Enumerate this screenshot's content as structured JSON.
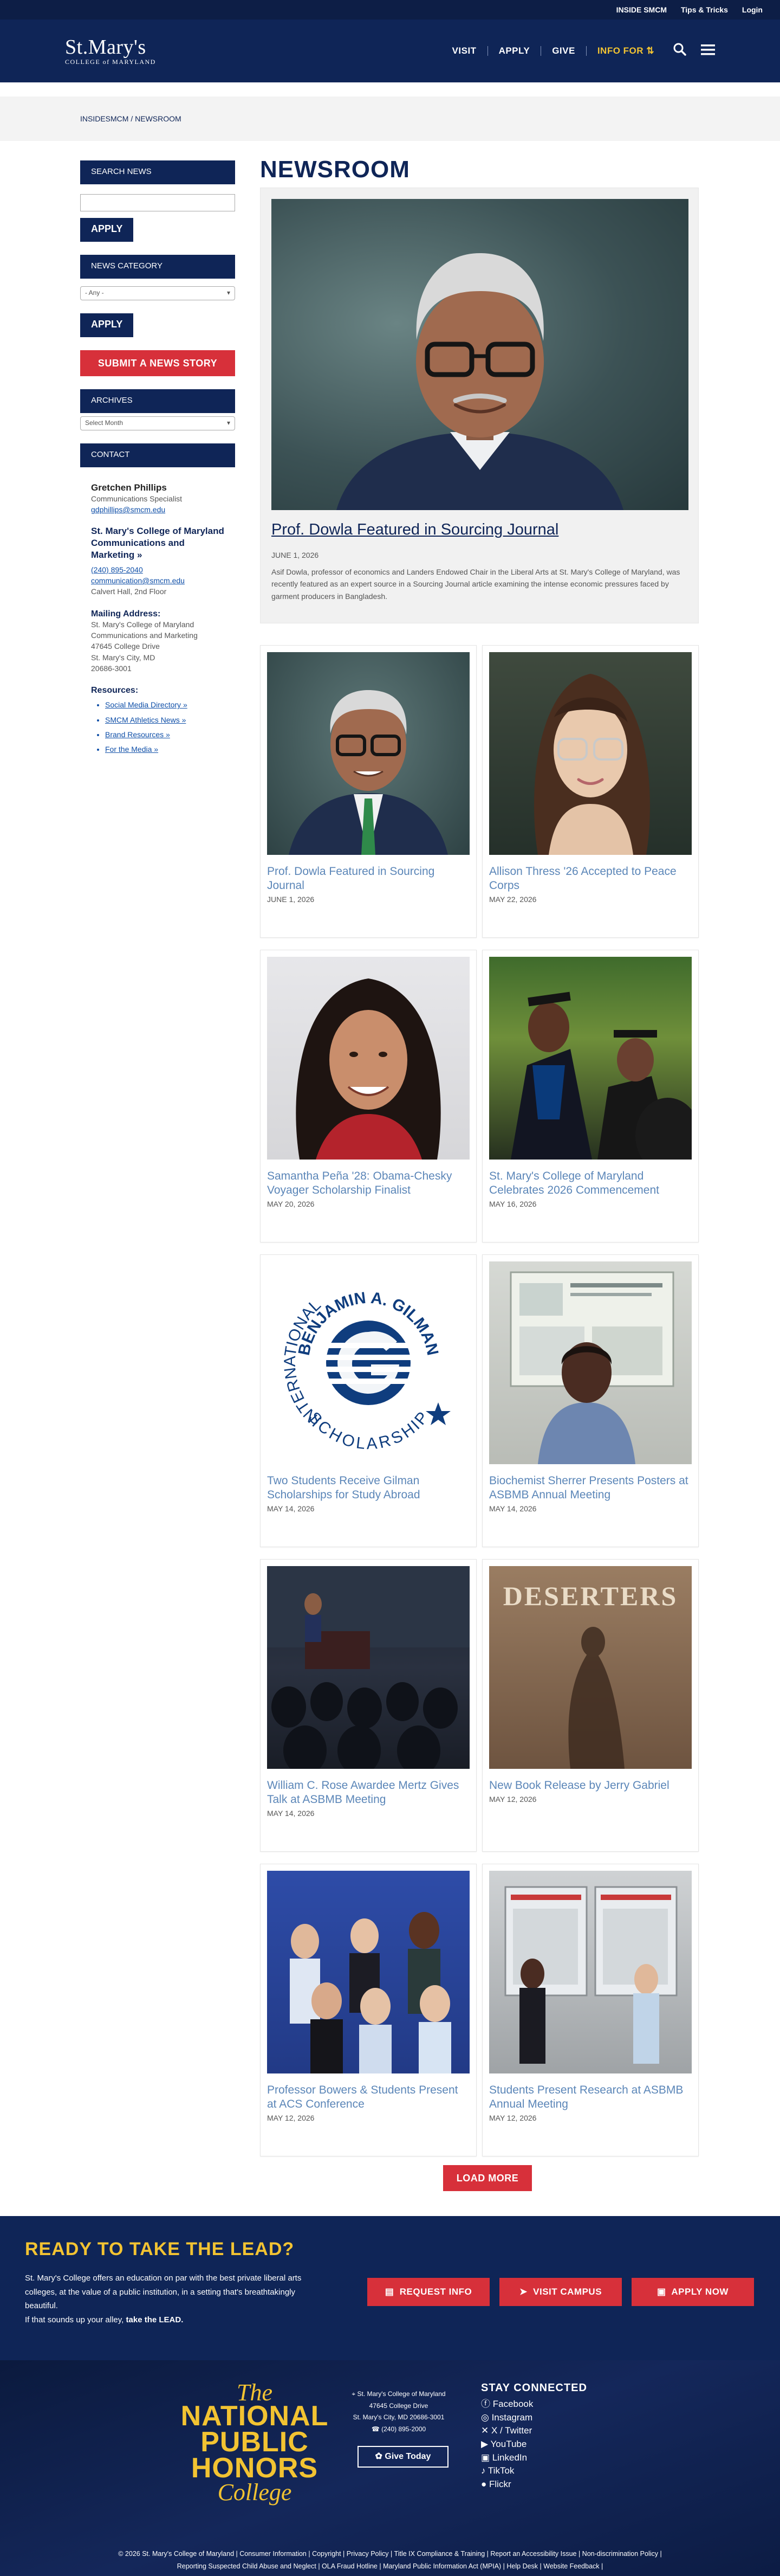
{
  "utility_bar": {
    "links": [
      "INSIDE SMCM",
      "Tips & Tricks",
      "Login"
    ]
  },
  "header": {
    "logo_main": "St.Mary's",
    "logo_sub": "COLLEGE of MARYLAND",
    "nav": [
      "VISIT",
      "APPLY",
      "GIVE"
    ],
    "info_for": "INFO FOR ⇅"
  },
  "breadcrumb": "INSIDESMCM / NEWSROOM",
  "sidebar": {
    "search_heading": "SEARCH NEWS",
    "apply_label": "APPLY",
    "category_heading": "NEWS CATEGORY",
    "category_value": "- Any -",
    "submit_label": "SUBMIT A NEWS STORY",
    "archives_heading": "ARCHIVES",
    "archives_value": "Select Month",
    "contact_heading": "CONTACT",
    "contact": {
      "name": "Gretchen Phillips",
      "title": "Communications Specialist",
      "email": "gdphillips@smcm.edu",
      "org": "St. Mary's College of Maryland Communications and Marketing »",
      "phone": "(240) 895-2040",
      "org_email": "communication@smcm.edu",
      "office": "Calvert Hall, 2nd Floor",
      "mailing_heading": "Mailing Address:",
      "mailing": [
        "St. Mary's College of Maryland",
        "Communications and Marketing",
        "47645 College Drive",
        "St. Mary's City, MD",
        "20686-3001"
      ],
      "resources_heading": "Resources:",
      "resources": [
        "Social Media Directory »",
        "SMCM Athletics News »",
        "Brand Resources »",
        "For the Media »"
      ]
    }
  },
  "main": {
    "title": "NEWSROOM",
    "featured": {
      "title": "Prof. Dowla Featured in Sourcing Journal",
      "date": "JUNE 1, 2026",
      "body": "Asif Dowla, professor of economics and Landers Endowed Chair in the Liberal Arts at St. Mary's College of Maryland, was recently featured as an expert source in a Sourcing Journal article examining the intense economic pressures faced by garment producers in Bangladesh."
    },
    "cards": [
      {
        "title": "Prof. Dowla Featured in Sourcing Journal",
        "date": "JUNE 1, 2026"
      },
      {
        "title": "Allison Thress '26 Accepted to Peace Corps",
        "date": "MAY 22, 2026"
      },
      {
        "title": "Samantha Peña '28: Obama-Chesky Voyager Scholarship Finalist",
        "date": "MAY 20, 2026"
      },
      {
        "title": "St. Mary's College of Maryland Celebrates 2026 Commencement",
        "date": "MAY 16, 2026"
      },
      {
        "title": "Two Students Receive Gilman Scholarships for Study Abroad",
        "date": "MAY 14, 2026"
      },
      {
        "title": "Biochemist Sherrer Presents Posters at ASBMB Annual Meeting",
        "date": "MAY 14, 2026"
      },
      {
        "title": "William C. Rose Awardee Mertz Gives Talk at ASBMB Meeting",
        "date": "MAY 14, 2026"
      },
      {
        "title": "New Book Release by Jerry Gabriel",
        "date": "MAY 12, 2026"
      },
      {
        "title": "Professor Bowers & Students Present at ACS Conference",
        "date": "MAY 12, 2026"
      },
      {
        "title": "Students Present Research at ASBMB Annual Meeting",
        "date": "MAY 12, 2026"
      }
    ],
    "gilman_logo": {
      "top": "BENJAMIN A. GILMAN",
      "left": "INTERNATIONAL",
      "bottom": "SCHOLARSHIP"
    },
    "book_title": "DESERTERS",
    "load_more": "LOAD MORE"
  },
  "cta": {
    "title": "READY TO TAKE THE LEAD?",
    "text": "St. Mary's College offers an education on par with the best private liberal arts colleges, at the value of a public institution, in a setting that's breathtakingly beautiful.",
    "text2": "If that sounds up your alley,",
    "text2_bold": "take the LEAD.",
    "buttons": [
      "REQUEST INFO",
      "VISIT CAMPUS",
      "APPLY NOW"
    ]
  },
  "footer": {
    "honors": [
      "The",
      "NATIONAL",
      "PUBLIC",
      "HONORS",
      "College"
    ],
    "address": [
      "St. Mary's College of Maryland",
      "47645 College Drive",
      "St. Mary's City, MD 20686-3001",
      "(240) 895-2000"
    ],
    "give_label": "Give Today",
    "stay_heading": "STAY CONNECTED",
    "social": [
      "Facebook",
      "Instagram",
      "X / Twitter",
      "YouTube",
      "LinkedIn",
      "TikTok",
      "Flickr"
    ],
    "legal_line1": "© 2026 St. Mary's College of Maryland  |  Consumer Information  |  Copyright  |  Privacy Policy  |  Title IX Compliance & Training  |  Report an Accessibility Issue  |  Non-discrimination Policy  |",
    "legal_line2": "Reporting Suspected Child Abuse and Neglect  |  OLA Fraud Hotline  |  Maryland Public Information Act (MPIA)  |  Help Desk  |  Website Feedback  |"
  },
  "colors": {
    "navy": "#0f2557",
    "gold": "#f2c332",
    "red": "#d7303a",
    "link_blue": "#5b86b8"
  }
}
